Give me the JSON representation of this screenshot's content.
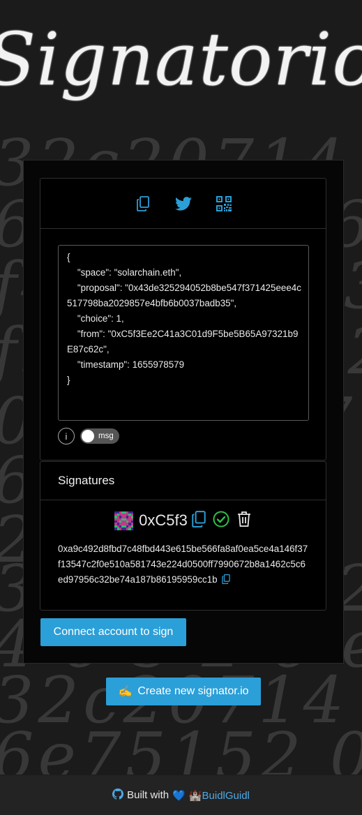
{
  "logo": {
    "text": "Signatorio"
  },
  "background_digits": [
    "32c20714 6869",
    "6e75657 6e02 04",
    "f4f0 71d03ae3",
    "f5 3f3 19 2 6610",
    "0 6c 1 1 7 7 2 3 4",
    "6f 6 f 35c 6 8",
    "2 3 6 8f 0 3 b",
    "3 c 7 6 9 2 1 2 4 5",
    "4 6 5 2 6 e d 6 9 6 e",
    "32c20714 6869",
    "6e75152 00"
  ],
  "toolbar": {
    "copy_icon": "copy-icon",
    "twitter_icon": "twitter-icon",
    "qr_icon": "qr-code-icon",
    "accent": "#2b9fd8"
  },
  "message": {
    "text": "{\n\t\"space\": \"solarchain.eth\",\n\t\"proposal\": \"0x43de325294052b8be547f371425eee4c517798ba2029857e4bfb6b0037badb35\",\n\t\"choice\": 1,\n\t\"from\": \"0xC5f3Ee2C41a3C01d9F5be5B65A97321b9E87c62c\",\n\t\"timestamp\": 1655978579\n}"
  },
  "info_label": "i",
  "toggle_label": "msg",
  "signatures": {
    "heading": "Signatures",
    "items": [
      {
        "address_short": "0xC5f3",
        "signature": "0xa9c492d8fbd7c48fbd443e615be566fa8af0ea5ce4a146f37f13547c2f0e510a581743e224d0500ff7990672b8a1462c5c6ed97956c32be74a187b86195959cc1b",
        "verified": true
      }
    ]
  },
  "connect_button": "Connect account to sign",
  "create_button": {
    "emoji": "✍️",
    "label": "Create new signator.io"
  },
  "footer": {
    "prefix": "Built with",
    "heart": "💙",
    "castle": "🏰",
    "link_label": "BuidlGuidl"
  }
}
